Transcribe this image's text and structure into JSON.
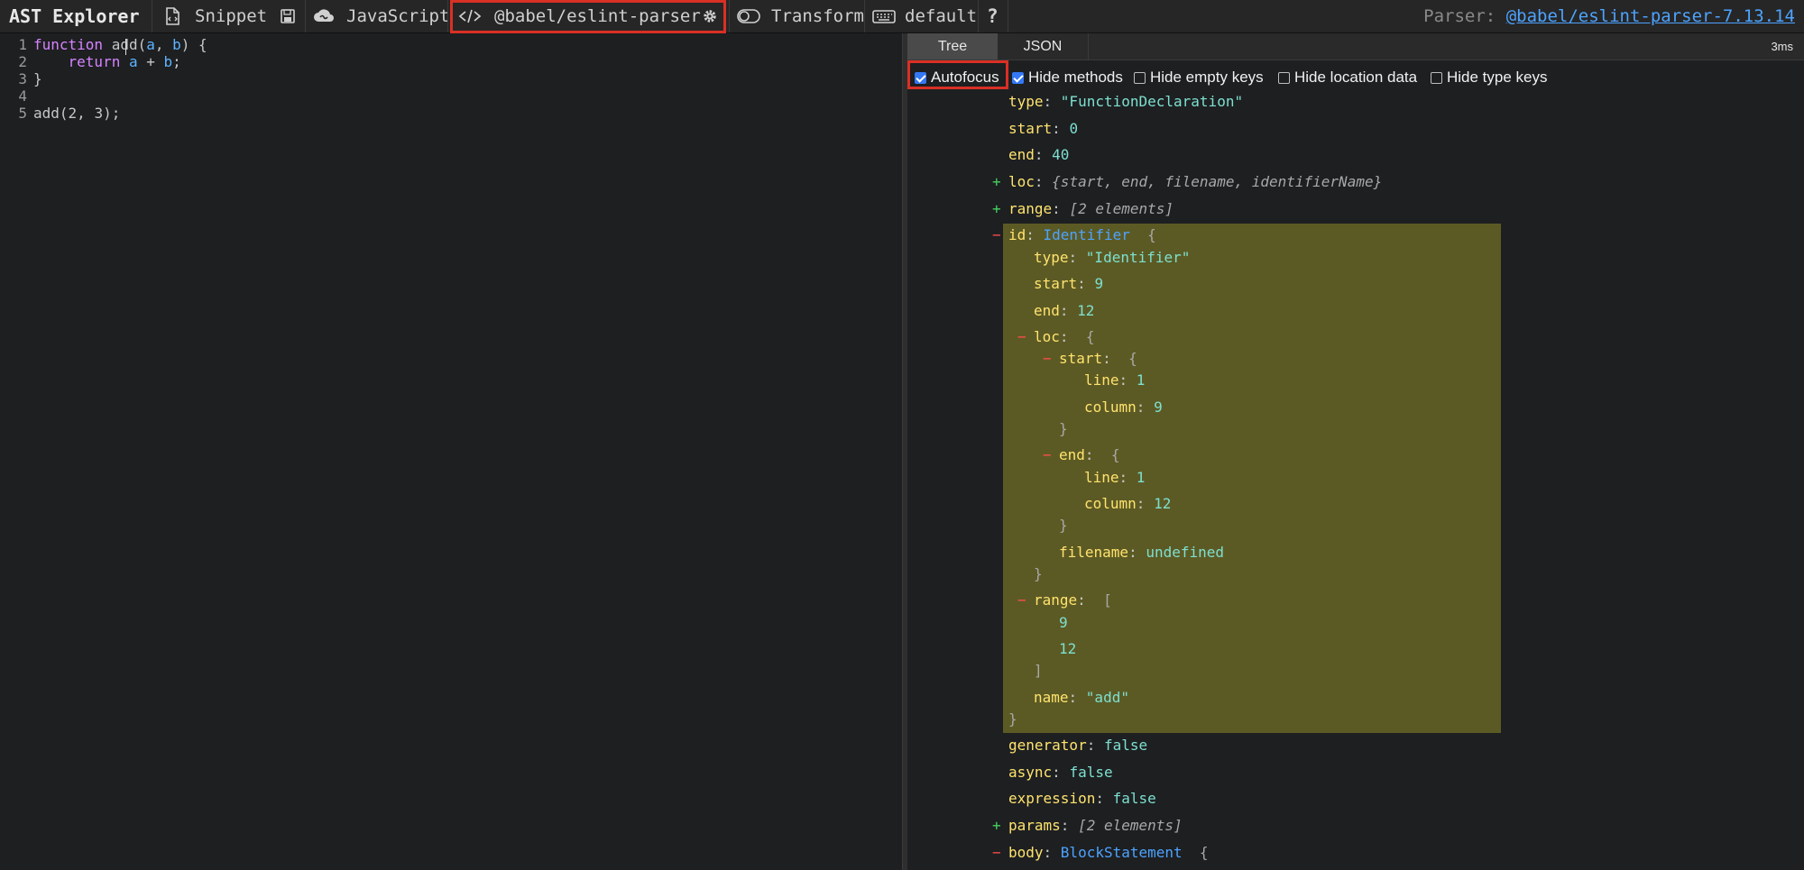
{
  "toolbar": {
    "brand": "AST Explorer",
    "snippet": "Snippet",
    "language": "JavaScript",
    "parser": "@babel/eslint-parser",
    "transform": "Transform",
    "keymap": "default",
    "help": "?",
    "parser_info_label": "Parser:",
    "parser_info_link": "@babel/eslint-parser-7.13.14"
  },
  "editor": {
    "lines": [
      {
        "num": "1"
      },
      {
        "num": "2"
      },
      {
        "num": "3"
      },
      {
        "num": "4"
      },
      {
        "num": "5"
      }
    ],
    "tokens": {
      "l1_kw": "function",
      "l1_name": " add",
      "l1_open": "(",
      "l1_a": "a",
      "l1_comma": ", ",
      "l1_b": "b",
      "l1_close": ") {",
      "l2_indent": "    ",
      "l2_kw": "return",
      "l2_a": " a",
      "l2_plus": " + ",
      "l2_b": "b",
      "l2_semi": ";",
      "l3": "}",
      "l5_call": "add(",
      "l5_2": "2",
      "l5_comma": ", ",
      "l5_3": "3",
      "l5_end": ");"
    }
  },
  "pane": {
    "tabs": [
      "Tree",
      "JSON"
    ],
    "timing": "3ms",
    "options": [
      {
        "label": "Autofocus",
        "checked": true
      },
      {
        "label": "Hide methods",
        "checked": true
      },
      {
        "label": "Hide empty keys",
        "checked": false
      },
      {
        "label": "Hide location data",
        "checked": false
      },
      {
        "label": "Hide type keys",
        "checked": false
      }
    ]
  },
  "tree": {
    "type_key": "type",
    "type_val": "\"FunctionDeclaration\"",
    "start_key": "start",
    "start_val": "0",
    "end_key": "end",
    "end_val": "40",
    "loc_key": "loc",
    "loc_summary": "{start, end, filename, identifierName}",
    "range_key": "range",
    "range_summary": "[2 elements]",
    "id_key": "id",
    "id_type": "Identifier",
    "id_type_key": "type",
    "id_type_val": "\"Identifier\"",
    "id_start_key": "start",
    "id_start_val": "9",
    "id_end_key": "end",
    "id_end_val": "12",
    "id_loc_key": "loc",
    "loc_start_key": "start",
    "line_key": "line",
    "line1_val": "1",
    "column_key": "column",
    "col1_val": "9",
    "loc_end_key": "end",
    "line2_val": "1",
    "col2_val": "12",
    "filename_key": "filename",
    "filename_val": "undefined",
    "id_range_key": "range",
    "range_v1": "9",
    "range_v2": "12",
    "name_key": "name",
    "name_val": "\"add\"",
    "generator_key": "generator",
    "generator_val": "false",
    "async_key": "async",
    "async_val": "false",
    "expression_key": "expression",
    "expression_val": "false",
    "params_key": "params",
    "params_summary": "[2 elements]",
    "body_key": "body",
    "body_type": "BlockStatement"
  },
  "colors": {
    "highlight": "#5c5a24",
    "key": "#ffe36e",
    "string": "#7ee0d0",
    "type": "#4da3ff",
    "annotation_border": "#d93025"
  },
  "icons": [
    "snippet-file-icon",
    "save-icon",
    "gist-cloud-icon",
    "code-brackets-icon",
    "settings-gear-icon",
    "transform-toggle-icon",
    "keyboard-icon"
  ]
}
